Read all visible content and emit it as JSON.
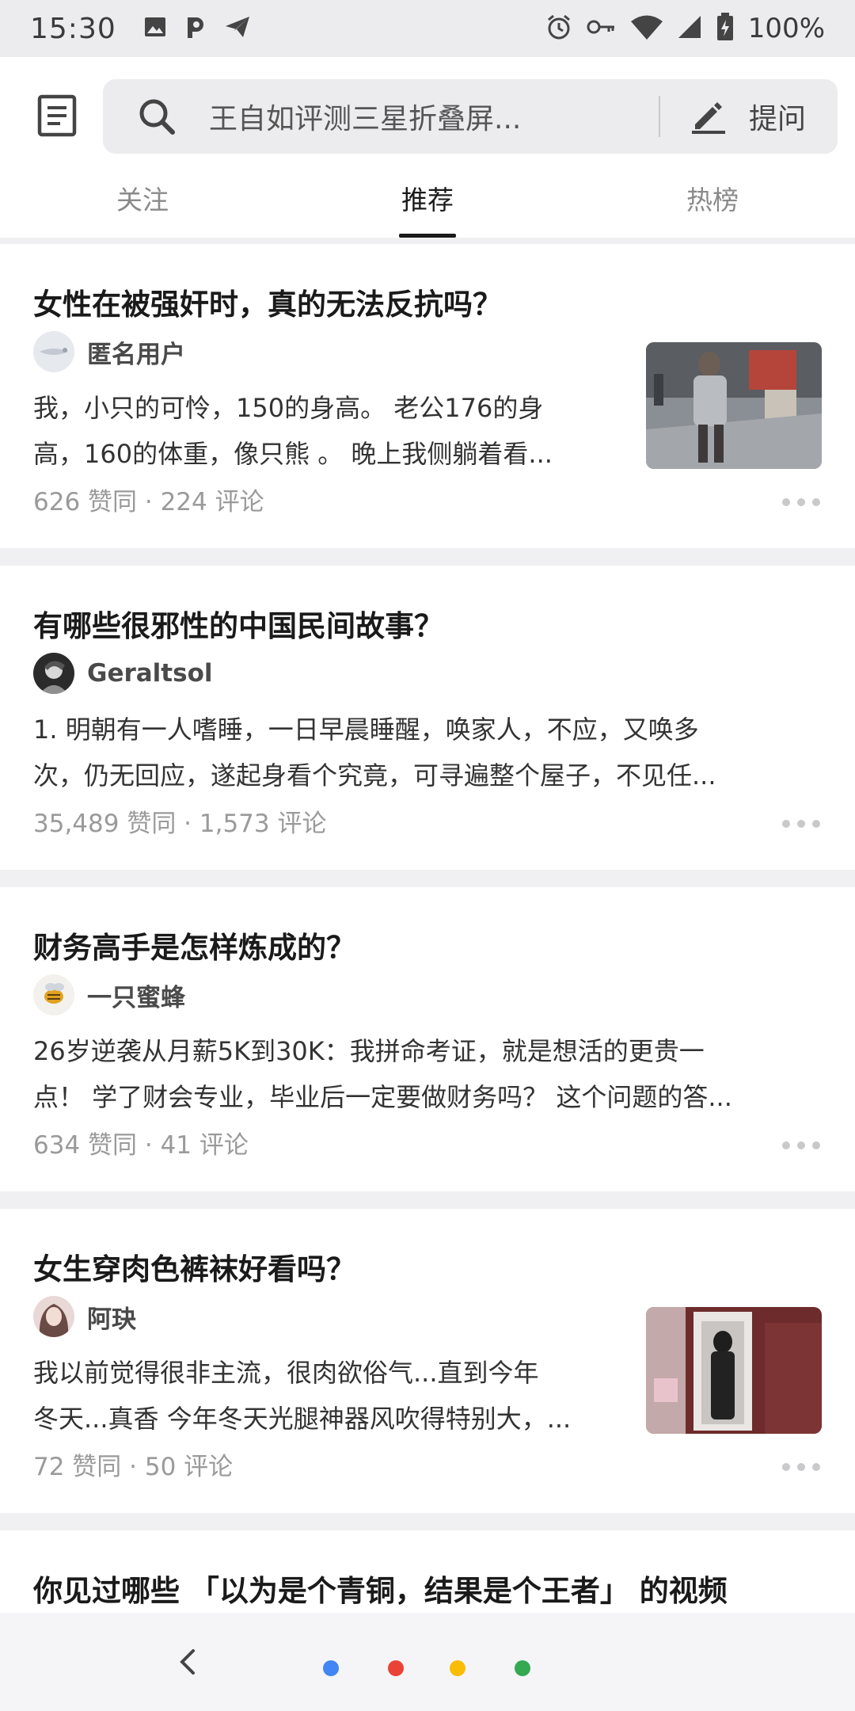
{
  "status_bar": {
    "time": "15:30",
    "battery": "100%",
    "left_icons": [
      "image-icon",
      "p-icon",
      "send-icon"
    ],
    "right_icons": [
      "alarm-icon",
      "key-icon",
      "wifi-icon",
      "signal-icon",
      "battery-icon"
    ]
  },
  "header": {
    "search_placeholder": "王自如评测三星折叠屏...",
    "ask_label": "提问",
    "tabs": [
      {
        "label": "关注",
        "active": false
      },
      {
        "label": "推荐",
        "active": true
      },
      {
        "label": "热榜",
        "active": false
      }
    ]
  },
  "feed": [
    {
      "title": "女性在被强奸时，真的无法反抗吗？",
      "author": "匿名用户",
      "excerpt_lines": [
        "我，小只的可怜，150的身高。 老公176的身",
        "高，160的体重，像只熊 。 晚上我侧躺着看..."
      ],
      "meta": "626 赞同 · 224 评论",
      "has_thumb": true
    },
    {
      "title": "有哪些很邪性的中国民间故事？",
      "author": "Geraltsol",
      "excerpt_lines": [
        "1. 明朝有一人嗜睡，一日早晨睡醒，唤家人，不应，又唤多",
        "次，仍无回应，遂起身看个究竟，可寻遍整个屋子，不见任..."
      ],
      "meta": "35,489 赞同 · 1,573 评论",
      "has_thumb": false
    },
    {
      "title": "财务高手是怎样炼成的？",
      "author": "一只蜜蜂",
      "excerpt_lines": [
        "26岁逆袭从月薪5K到30K：我拼命考证，就是想活的更贵一",
        "点！ 学了财会专业，毕业后一定要做财务吗？ 这个问题的答..."
      ],
      "meta": "634 赞同 · 41 评论",
      "has_thumb": false
    },
    {
      "title": "女生穿肉色裤袜好看吗？",
      "author": "阿玦",
      "excerpt_lines": [
        "我以前觉得很非主流，很肉欲俗气...直到今年",
        "冬天...真香 今年冬天光腿神器风吹得特别大，..."
      ],
      "meta": "72 赞同 · 50 评论",
      "has_thumb": true
    },
    {
      "title": "你见过哪些 「以为是个青铜，结果是个王者」 的视频"
    }
  ],
  "bottom_nav": {
    "dot_colors": [
      "#4285f4",
      "#ea4335",
      "#fbbc05",
      "#34a853"
    ]
  }
}
